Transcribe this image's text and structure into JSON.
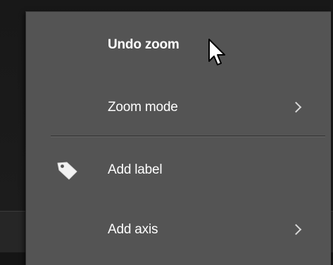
{
  "context_menu": {
    "items": [
      {
        "label": "Undo zoom",
        "bold": true,
        "submenu": false,
        "icon": null
      },
      {
        "label": "Zoom mode",
        "bold": false,
        "submenu": true,
        "icon": null
      },
      {
        "label": "Add label",
        "bold": false,
        "submenu": false,
        "icon": "tag-icon"
      },
      {
        "label": "Add axis",
        "bold": false,
        "submenu": true,
        "icon": null
      }
    ]
  },
  "colors": {
    "menu_background": "#545454",
    "text": "#ffffff",
    "page_background": "#151515"
  }
}
